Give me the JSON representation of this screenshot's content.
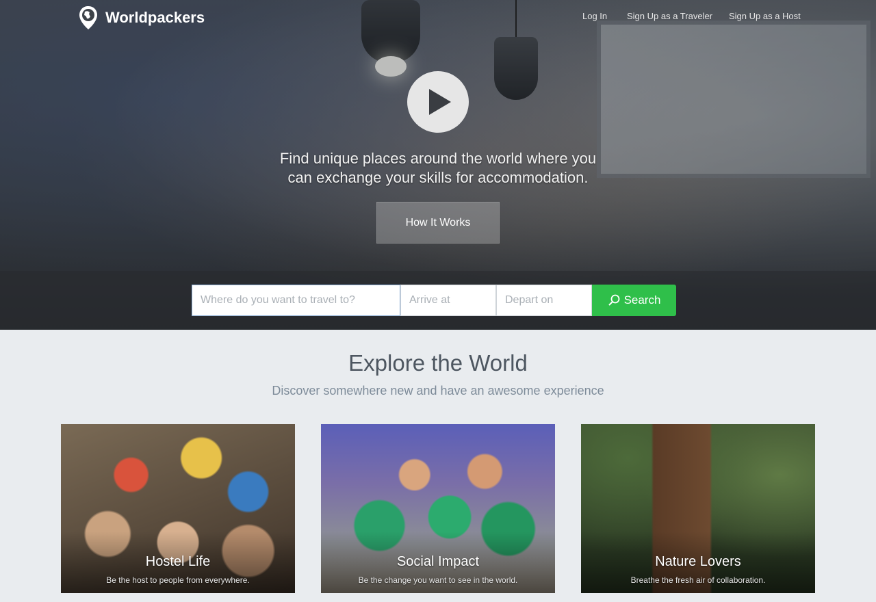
{
  "brand": {
    "name": "Worldpackers",
    "icon": "globe-pin-icon"
  },
  "nav": {
    "login": "Log In",
    "signup_traveler": "Sign Up as a Traveler",
    "signup_host": "Sign Up as a Host"
  },
  "hero": {
    "tagline_line1": "Find unique places around the world where you",
    "tagline_line2": "can exchange your skills for accommodation.",
    "how_it_works": "How It Works",
    "play_icon": "play-icon"
  },
  "search": {
    "destination_placeholder": "Where do you want to travel to?",
    "arrive_placeholder": "Arrive at",
    "depart_placeholder": "Depart on",
    "button_label": "Search",
    "button_color": "#2fbf4a"
  },
  "explore": {
    "title": "Explore the World",
    "subtitle": "Discover somewhere new and have an awesome experience",
    "cards": [
      {
        "title": "Hostel Life",
        "desc": "Be the host to people from everywhere."
      },
      {
        "title": "Social Impact",
        "desc": "Be the change you want to see in the world."
      },
      {
        "title": "Nature Lovers",
        "desc": "Breathe the fresh air of collaboration."
      }
    ]
  }
}
